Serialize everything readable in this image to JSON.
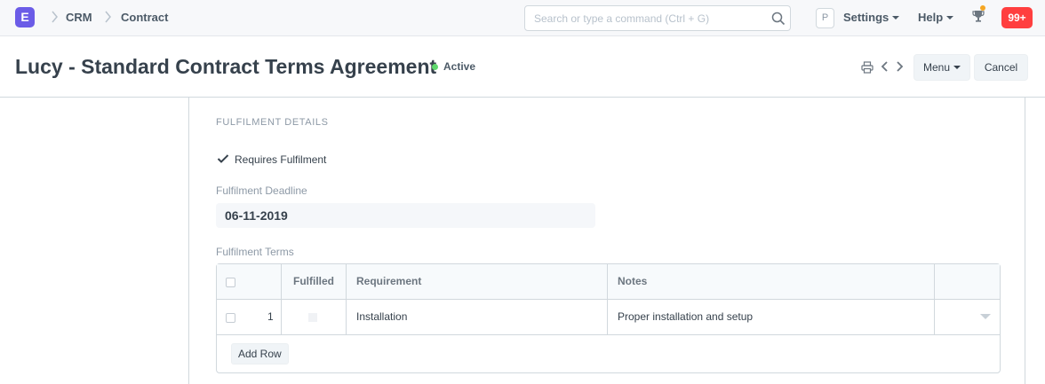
{
  "navbar": {
    "logo_letter": "E",
    "breadcrumbs": [
      "CRM",
      "Contract"
    ],
    "search_placeholder": "Search or type a command (Ctrl + G)",
    "user_initial": "P",
    "settings_label": "Settings",
    "help_label": "Help",
    "notification_count": "99+"
  },
  "page_head": {
    "title": "Lucy - Standard Contract Terms Agreement",
    "status": "Active",
    "status_color": "#5fd86d",
    "menu_label": "Menu",
    "cancel_label": "Cancel"
  },
  "form": {
    "section_title": "FULFILMENT DETAILS",
    "requires_fulfilment_label": "Requires Fulfilment",
    "requires_fulfilment_checked": true,
    "deadline_label": "Fulfilment Deadline",
    "deadline_value": "06-11-2019",
    "terms_label": "Fulfilment Terms",
    "grid": {
      "columns": [
        "Fulfilled",
        "Requirement",
        "Notes"
      ],
      "rows": [
        {
          "idx": "1",
          "fulfilled": false,
          "requirement": "Installation",
          "notes": "Proper installation and setup"
        }
      ],
      "add_row_label": "Add Row"
    }
  },
  "colors": {
    "brand": "#6b5ce7",
    "notification": "#ff3f3f"
  }
}
